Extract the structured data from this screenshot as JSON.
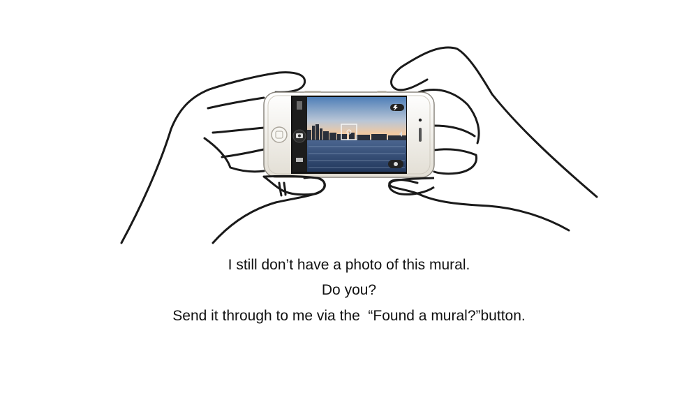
{
  "caption": {
    "line1": "I still don’t have a photo of this mural.",
    "line2": "Do you?",
    "line3": "Send it through to me via the  “Found a mural?”button."
  },
  "colors": {
    "background": "#ffffff",
    "text": "#111111",
    "hand_outline": "#1a1a1a",
    "phone_body": "#f2f0ea",
    "phone_bezel": "#111111",
    "sky_top": "#4f7fb8",
    "sky_horizon": "#f3c9a0",
    "water": "#2f4a73"
  },
  "illustration": {
    "icons": [
      "hands-outline",
      "smartphone-icon",
      "home-button-icon",
      "camera-icon",
      "focus-box-icon",
      "flash-icon",
      "shutter-icon"
    ]
  }
}
